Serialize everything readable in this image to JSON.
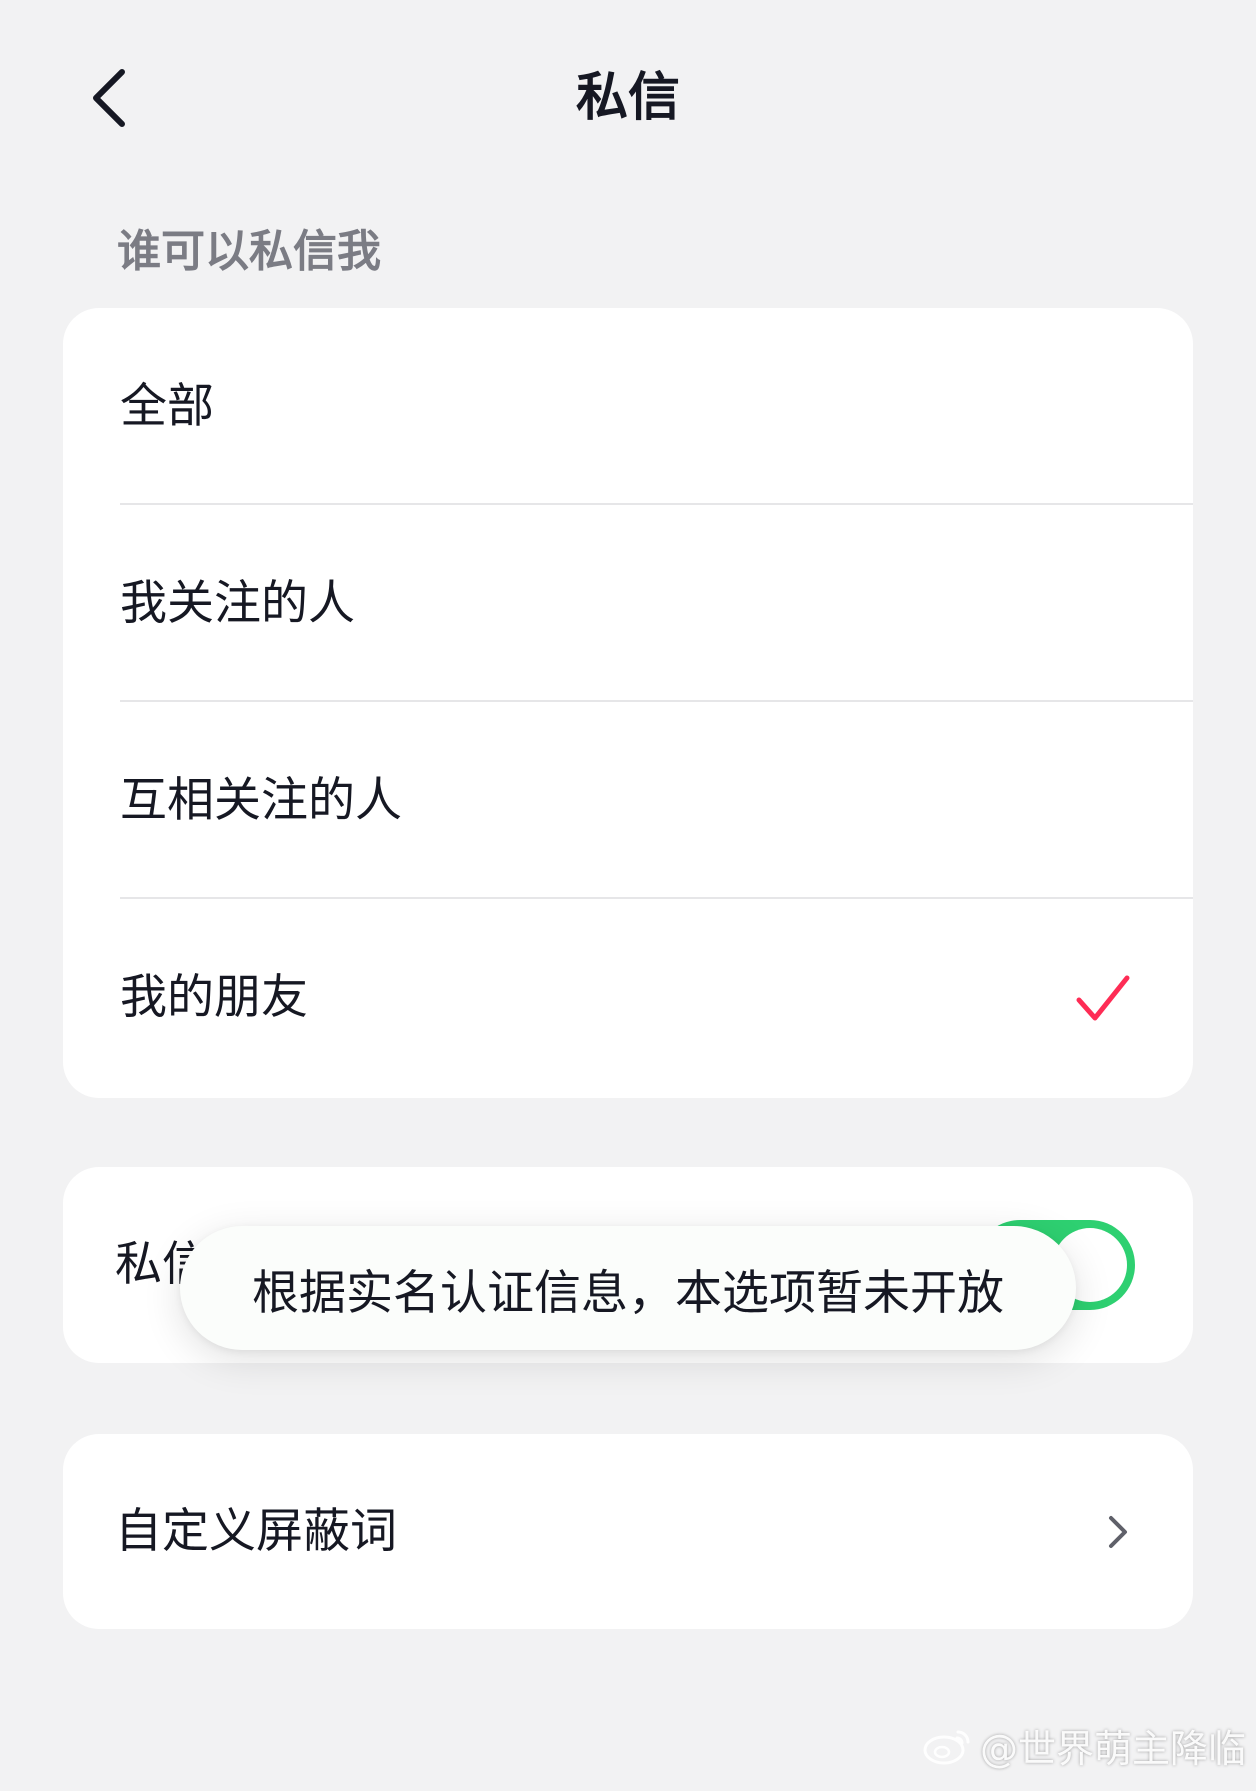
{
  "header": {
    "title": "私信",
    "back_icon": "chevron-left-icon"
  },
  "privacy": {
    "section_label": "谁可以私信我",
    "options": [
      {
        "label": "全部",
        "selected": false
      },
      {
        "label": "我关注的人",
        "selected": false
      },
      {
        "label": "互相关注的人",
        "selected": false
      },
      {
        "label": "我的朋友",
        "selected": true
      }
    ],
    "check_icon": "checkmark-icon",
    "check_color": "#fe2c55"
  },
  "toggle_row": {
    "label": "私信",
    "enabled": true,
    "toggle_color": "#2ed071"
  },
  "toast": {
    "text": "根据实名认证信息，本选项暂未开放"
  },
  "blocked_words": {
    "label": "自定义屏蔽词",
    "chevron_icon": "chevron-right-icon"
  },
  "watermark": {
    "text": "@世界萌主降临",
    "icon": "weibo-icon"
  }
}
